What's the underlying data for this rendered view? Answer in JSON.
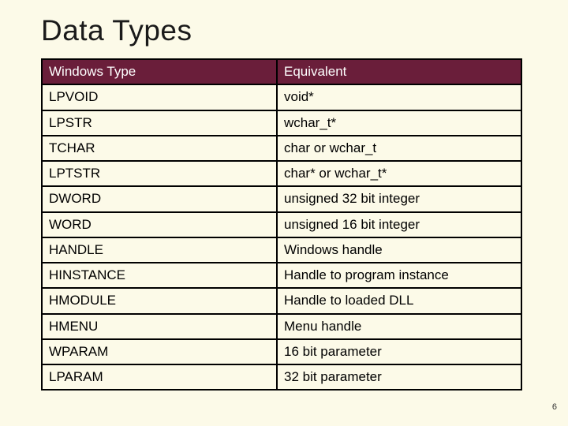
{
  "title": "Data Types",
  "headers": {
    "col1": "Windows Type",
    "col2": "Equivalent"
  },
  "rows": [
    {
      "wt": "LPVOID",
      "eq": "void*"
    },
    {
      "wt": "LPSTR",
      "eq": "wchar_t*"
    },
    {
      "wt": "TCHAR",
      "eq": "char or wchar_t"
    },
    {
      "wt": "LPTSTR",
      "eq": "char* or wchar_t*"
    },
    {
      "wt": "DWORD",
      "eq": "unsigned 32 bit integer"
    },
    {
      "wt": "WORD",
      "eq": "unsigned 16 bit integer"
    },
    {
      "wt": "HANDLE",
      "eq": "Windows handle"
    },
    {
      "wt": "HINSTANCE",
      "eq": "Handle to program instance"
    },
    {
      "wt": "HMODULE",
      "eq": "Handle to loaded DLL"
    },
    {
      "wt": "HMENU",
      "eq": "Menu handle"
    },
    {
      "wt": "WPARAM",
      "eq": "16 bit parameter"
    },
    {
      "wt": "LPARAM",
      "eq": "32 bit parameter"
    }
  ],
  "page_number": "6"
}
